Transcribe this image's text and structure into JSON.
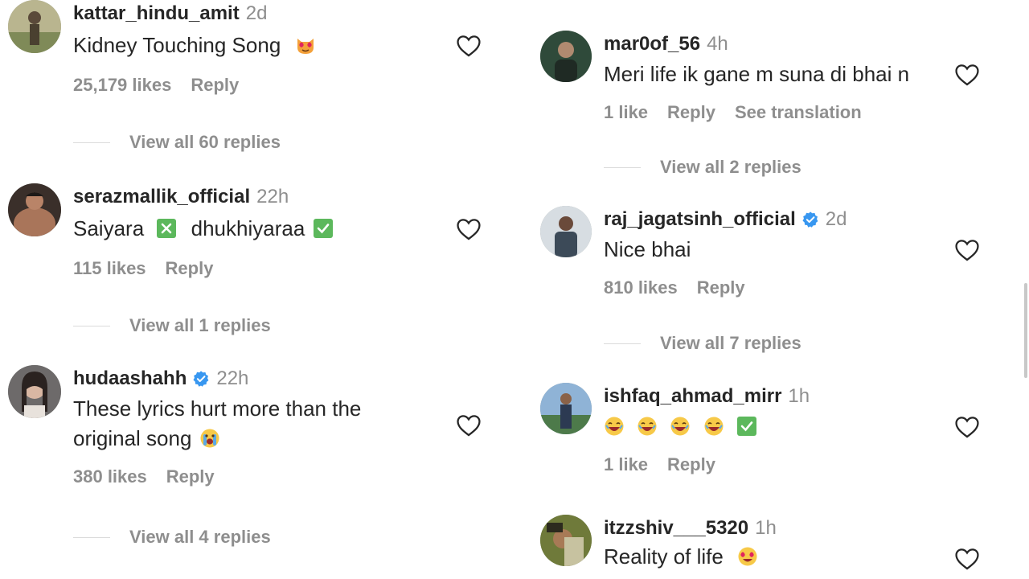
{
  "left_comments": [
    {
      "username": "kattar_hindu_amit",
      "verified": false,
      "time": "2d",
      "text": "Kidney Touching Song",
      "emoji": [
        "cat-heart-eyes"
      ],
      "likes": "25,179 likes",
      "reply": "Reply",
      "view_replies": "View all 60 replies"
    },
    {
      "username": "serazmallik_official",
      "verified": false,
      "time": "22h",
      "text_parts": [
        "Saiyara",
        "dhukhiyaraa"
      ],
      "likes": "115 likes",
      "reply": "Reply",
      "view_replies": "View all 1 replies"
    },
    {
      "username": "hudaashahh",
      "verified": true,
      "time": "22h",
      "text_line1": "These lyrics hurt more than the",
      "text_line2": "original song",
      "likes": "380 likes",
      "reply": "Reply",
      "view_replies": "View all 4 replies"
    }
  ],
  "right_comments": [
    {
      "username": "mar0of_56",
      "verified": false,
      "time": "4h",
      "text": "Meri life ik gane m suna di bhai n",
      "likes": "1 like",
      "reply": "Reply",
      "translation": "See translation",
      "view_replies": "View all 2 replies"
    },
    {
      "username": "raj_jagatsinh_official",
      "verified": true,
      "time": "2d",
      "text": "Nice bhai",
      "likes": "810 likes",
      "reply": "Reply",
      "view_replies": "View all 7 replies"
    },
    {
      "username": "ishfaq_ahmad_mirr",
      "verified": false,
      "time": "1h",
      "emoji": [
        "laughing",
        "laughing",
        "laughing",
        "laughing",
        "check-mark"
      ],
      "likes": "1 like",
      "reply": "Reply"
    },
    {
      "username": "itzzshiv___5320",
      "verified": false,
      "time": "1h",
      "text": "Reality of life",
      "emoji": [
        "heart-eyes"
      ]
    }
  ],
  "colors": {
    "username": "#262626",
    "meta": "#8e8e8e",
    "verified": "#3897f0",
    "divider": "#dbdbdb"
  },
  "icons": {
    "like": "heart-outline-icon",
    "verified": "verified-badge-icon"
  }
}
